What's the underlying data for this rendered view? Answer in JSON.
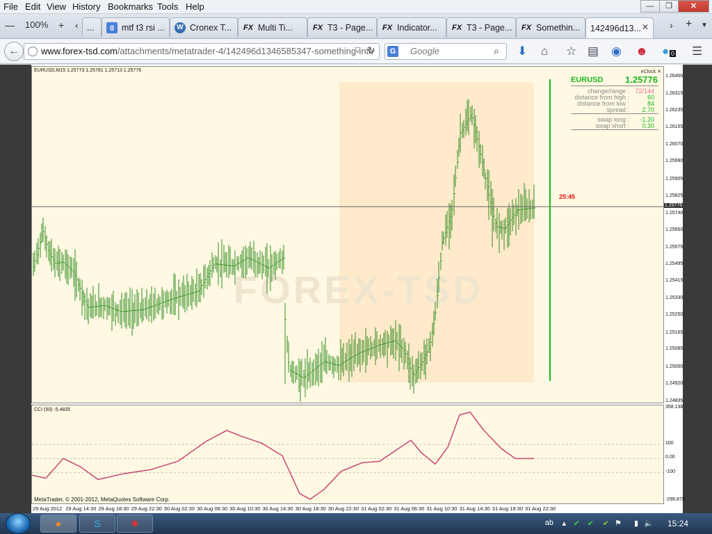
{
  "menu": [
    "File",
    "Edit",
    "View",
    "History",
    "Bookmarks",
    "Tools",
    "Help"
  ],
  "zoom": "100%",
  "tabs": [
    {
      "label": "...",
      "icon": "page-icon"
    },
    {
      "label": "mtf t3 rsi ...",
      "icon": "google-icon"
    },
    {
      "label": "Cronex T...",
      "icon": "wordpress-icon"
    },
    {
      "label": "Multi Ti...",
      "icon": "forex-tsd-icon"
    },
    {
      "label": "T3 - Page...",
      "icon": "forex-tsd-icon"
    },
    {
      "label": "Indicator...",
      "icon": "forex-tsd-icon"
    },
    {
      "label": "T3 - Page...",
      "icon": "forex-tsd-icon"
    },
    {
      "label": "Somethin...",
      "icon": "forex-tsd-icon"
    },
    {
      "label": "142496d13...",
      "icon": "page-icon",
      "active": true
    }
  ],
  "url": {
    "host": "www.forex-tsd.com",
    "path": "/attachments/metatrader-4/142496d1346585347-something-inte"
  },
  "search": {
    "engine": "G",
    "placeholder": "Google"
  },
  "chart": {
    "symbol_line": "EURUSD,M15  1.25773 1.25781 1.25713 1.25776",
    "timer": "25:45",
    "price_ticks": [
      "1.26400",
      "1.26315",
      "1.26235",
      "1.26155",
      "1.26070",
      "1.25990",
      "1.25905",
      "1.25825",
      "1.25740",
      "1.25660",
      "1.25575",
      "1.25495",
      "1.25415",
      "1.25330",
      "1.25250",
      "1.25165",
      "1.25085",
      "1.25000",
      "1.24920",
      "1.24835"
    ],
    "current_price_label": "1.25776",
    "cci_label": "CCI (50) -5.4835",
    "cci_ticks": [
      "358.138",
      "100",
      "0.00",
      "-100",
      "-299.879"
    ],
    "copyright": "MetaTrader, © 2001-2012, MetaQuotes Software Corp.",
    "time_labels": [
      "29 Aug 2012",
      "29 Aug 14:30",
      "29 Aug 18:30",
      "29 Aug 22:30",
      "30 Aug 02:30",
      "30 Aug 06:30",
      "30 Aug 10:30",
      "30 Aug 14:30",
      "30 Aug 18:30",
      "30 Aug 22:30",
      "31 Aug 02:30",
      "31 Aug 06:30",
      "31 Aug 10:30",
      "31 Aug 14:30",
      "31 Aug 18:30",
      "31 Aug 22:30"
    ],
    "watermark": "FOREX-TSD",
    "bar_color": "#2e8b1e",
    "cci_color": "#c8507a",
    "bg_color": "#fff9e3",
    "highlight_color": "#ffe6c4"
  },
  "eclock": {
    "title": "eClock",
    "pair": "EURUSD",
    "price": "1.25776",
    "rows": [
      {
        "k": "change/range :",
        "v": "72/144",
        "color": "#e06a8a"
      },
      {
        "k": "distance from high :",
        "v": "60",
        "color": "#1bb81b"
      },
      {
        "k": "distance from low :",
        "v": "84",
        "color": "#1bb81b"
      },
      {
        "k": "spread :",
        "v": "2.70",
        "color": "#1bb81b"
      },
      {
        "k": "swap long :",
        "v": "-1.20",
        "color": "#1bb81b"
      },
      {
        "k": "swap short :",
        "v": "0.30",
        "color": "#1bb81b"
      }
    ]
  },
  "taskbar": {
    "clock": "15:24",
    "tray_badge": "0"
  }
}
